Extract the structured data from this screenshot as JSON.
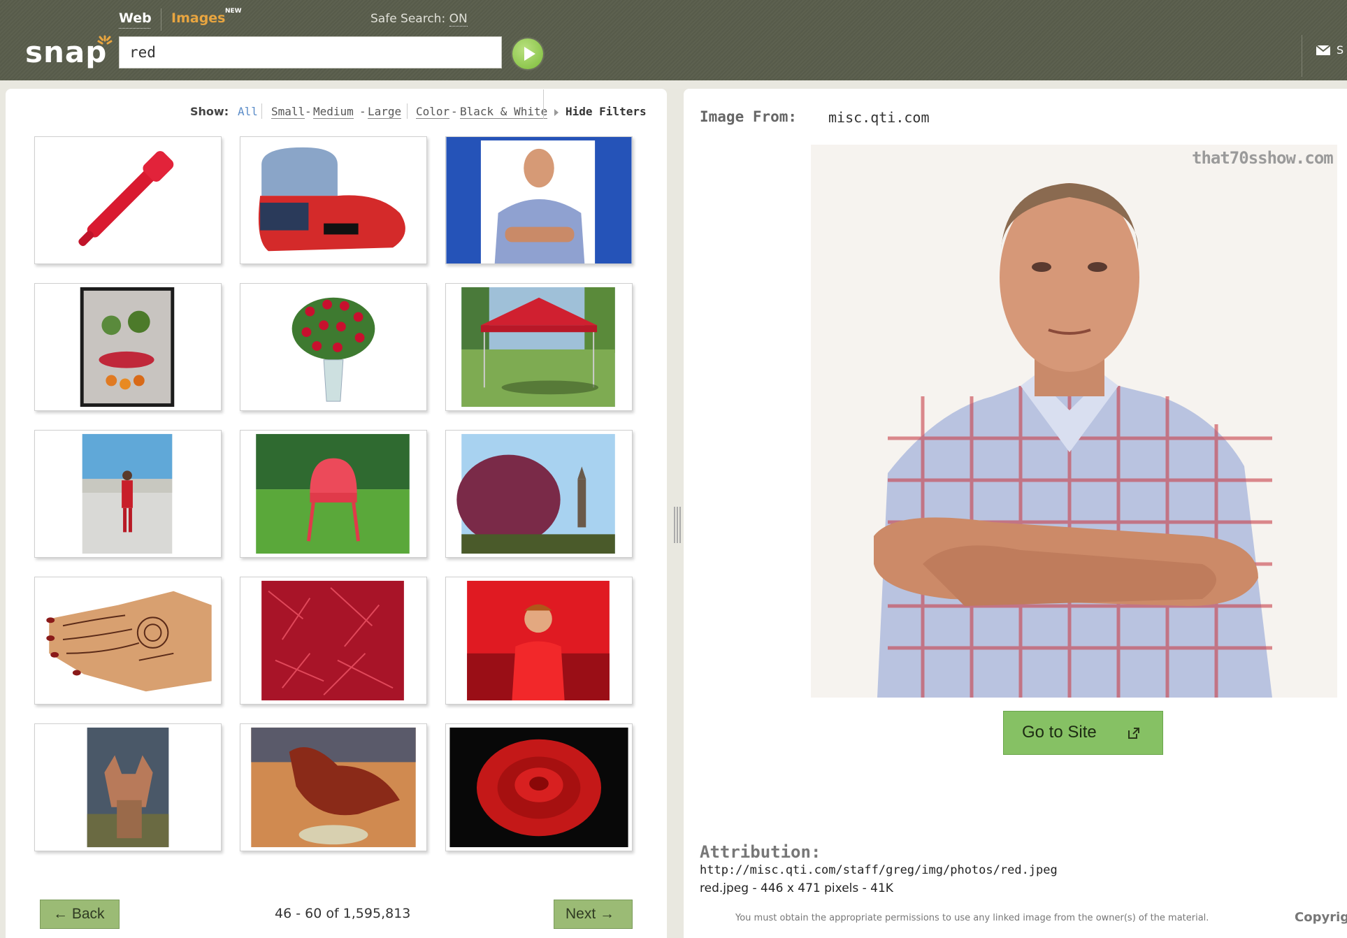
{
  "header": {
    "tab_web": "Web",
    "tab_images": "Images",
    "tab_images_badge": "NEW",
    "safe_search_label": "Safe Search:",
    "safe_search_value": "ON",
    "logo_text": "snap",
    "search_value": "red",
    "mail_label": "S"
  },
  "filters": {
    "show_label": "Show:",
    "all": "All",
    "small": "Small",
    "medium": "Medium",
    "large": "Large",
    "color": "Color",
    "black_white": "Black & White",
    "hide_filters": "Hide Filters",
    "dash": "-"
  },
  "thumbnails": [
    {
      "name": "thumb-red-flashlight",
      "icon": "flashlight"
    },
    {
      "name": "thumb-red-slipper",
      "icon": "slipper"
    },
    {
      "name": "thumb-man-plaid-shirt",
      "icon": "portrait"
    },
    {
      "name": "thumb-fruit-mosaic",
      "icon": "mosaic"
    },
    {
      "name": "thumb-red-roses-vase",
      "icon": "roses"
    },
    {
      "name": "thumb-red-canopy",
      "icon": "canopy"
    },
    {
      "name": "thumb-woman-red-outfit",
      "icon": "woman"
    },
    {
      "name": "thumb-red-lawn-chair",
      "icon": "chair"
    },
    {
      "name": "thumb-red-tree",
      "icon": "tree"
    },
    {
      "name": "thumb-henna-hand",
      "icon": "hand"
    },
    {
      "name": "thumb-red-grass",
      "icon": "grass"
    },
    {
      "name": "thumb-boy-red-shirt",
      "icon": "boy"
    },
    {
      "name": "thumb-red-fox",
      "icon": "fox"
    },
    {
      "name": "thumb-red-bird",
      "icon": "bird"
    },
    {
      "name": "thumb-red-rose",
      "icon": "rose"
    }
  ],
  "pager": {
    "back": "Back",
    "count": "46 - 60 of 1,595,813",
    "next": "Next"
  },
  "detail": {
    "image_from_label": "Image From:",
    "image_from_value": "misc.qti.com",
    "watermark": "that70sshow.com",
    "go_to_site": "Go to Site",
    "attribution_label": "Attribution:",
    "attribution_url": "http://misc.qti.com/staff/greg/img/photos/red.jpeg",
    "attribution_meta": "red.jpeg - 446 x 471 pixels - 41K",
    "disclaimer": "You must obtain the appropriate permissions to use any linked image from the owner(s) of the material.",
    "copyright": "Copyrig"
  },
  "colors": {
    "header_bg": "#5d6150",
    "accent_orange": "#e8a540",
    "link_blue": "#5b8cc8",
    "button_green": "#9bbb75",
    "go_site_green": "#86c164"
  }
}
